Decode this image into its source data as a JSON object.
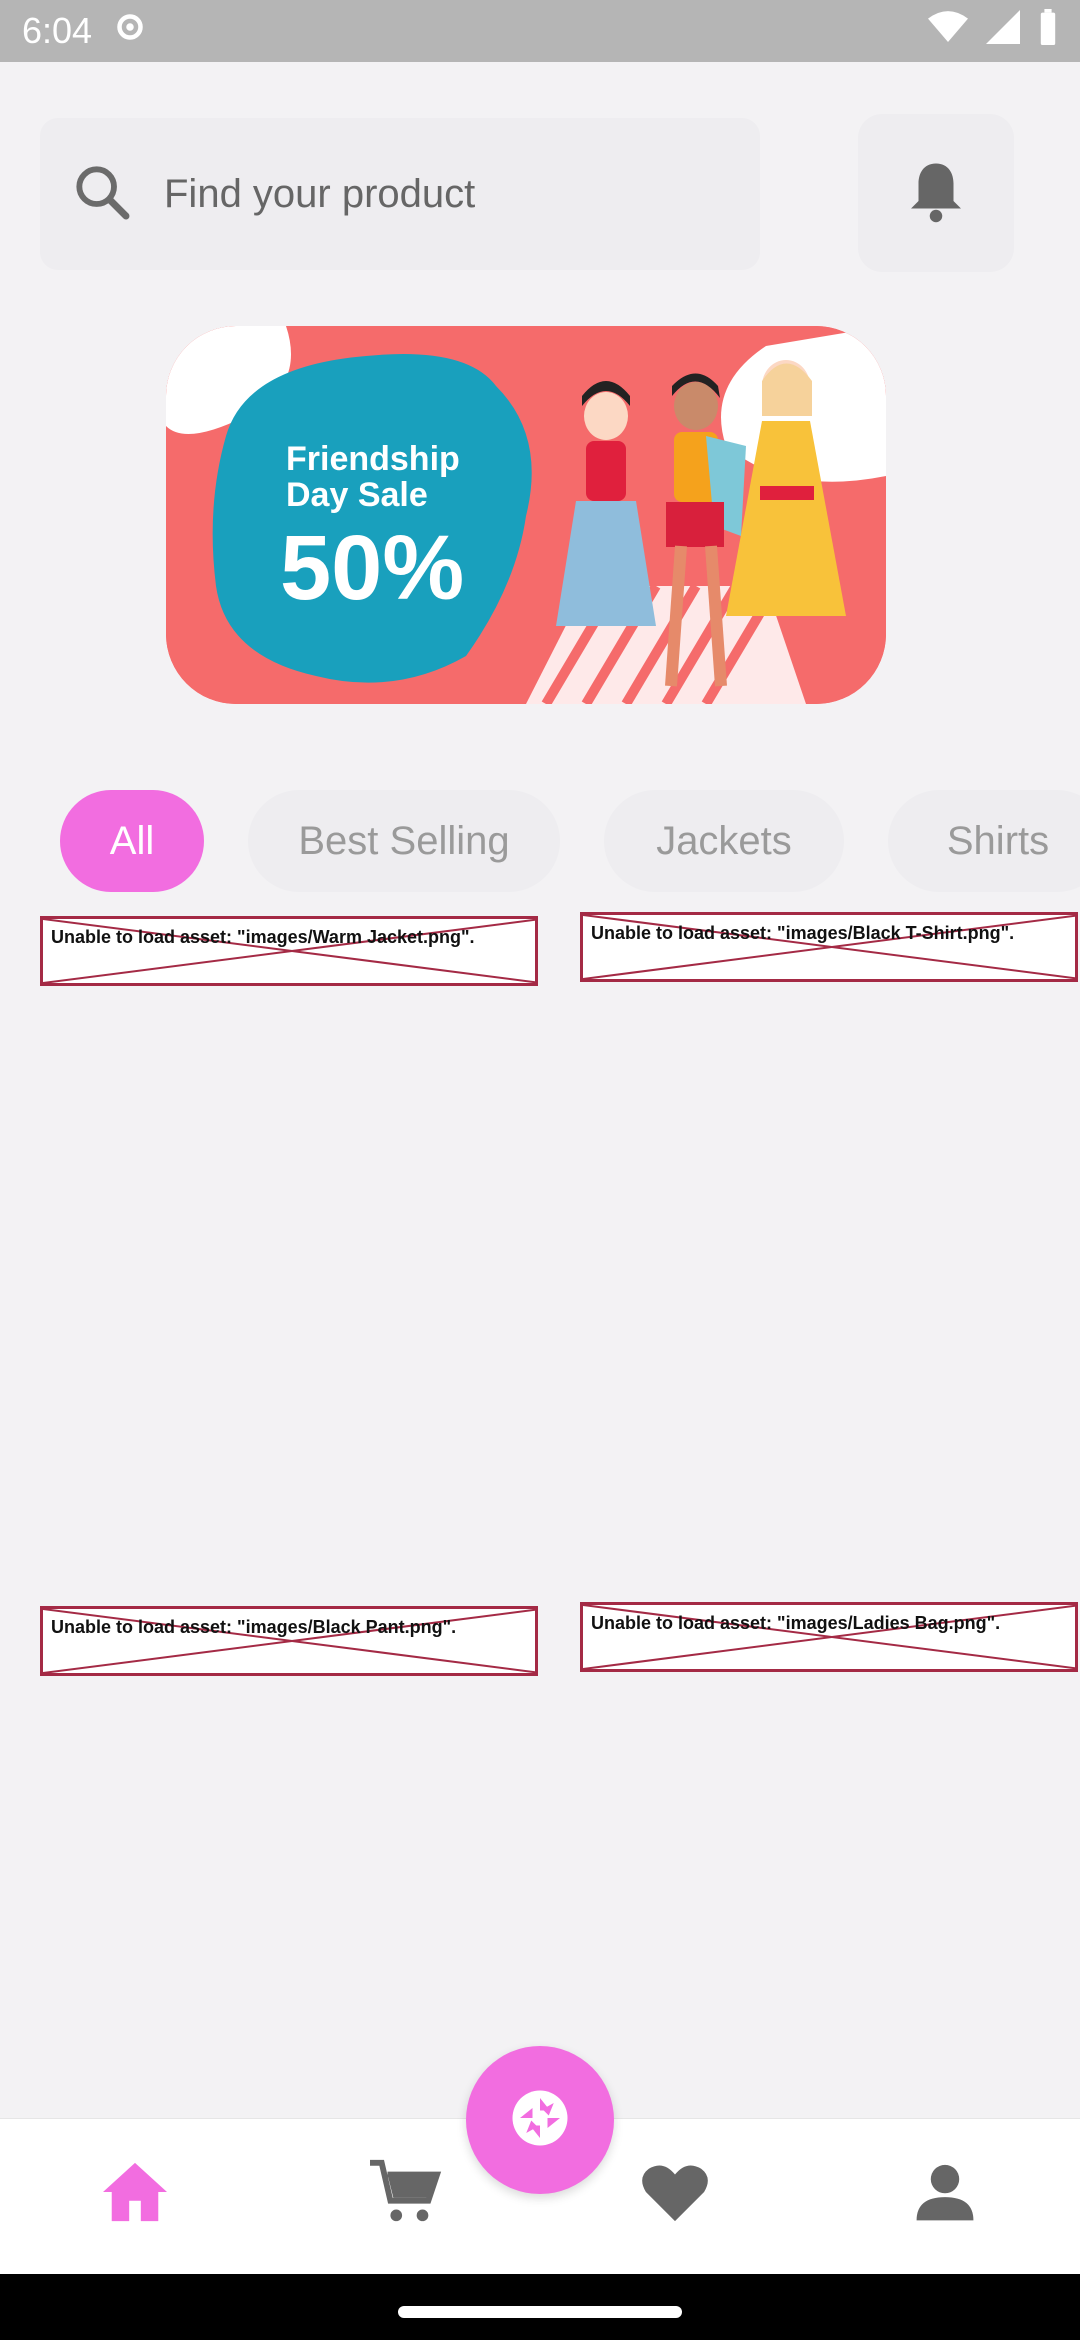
{
  "status_bar": {
    "time": "6:04"
  },
  "search": {
    "placeholder": "Find your product"
  },
  "banner": {
    "line1": "Friendship",
    "line2": "Day Sale",
    "discount": "50%"
  },
  "chips": [
    {
      "label": "All",
      "active": true
    },
    {
      "label": "Best Selling",
      "active": false
    },
    {
      "label": "Jackets",
      "active": false
    },
    {
      "label": "Shirts",
      "active": false
    }
  ],
  "products": [
    {
      "error_text": "Unable to load asset: \"images/Warm Jacket.png\"."
    },
    {
      "error_text": "Unable to load asset: \"images/Black T-Shirt.png\"."
    },
    {
      "error_text": "Unable to load asset: \"images/Black Pant.png\"."
    },
    {
      "error_text": "Unable to load asset: \"images/Ladies Bag.png\"."
    }
  ],
  "colors": {
    "accent": "#f26de0",
    "background": "#f3f2f4",
    "error_border": "#a42a45"
  },
  "icons": {
    "search": "search-icon",
    "bell": "bell-icon",
    "home": "home-icon",
    "cart": "cart-icon",
    "heart": "heart-icon",
    "profile": "profile-icon",
    "camera": "camera-aperture-icon"
  }
}
